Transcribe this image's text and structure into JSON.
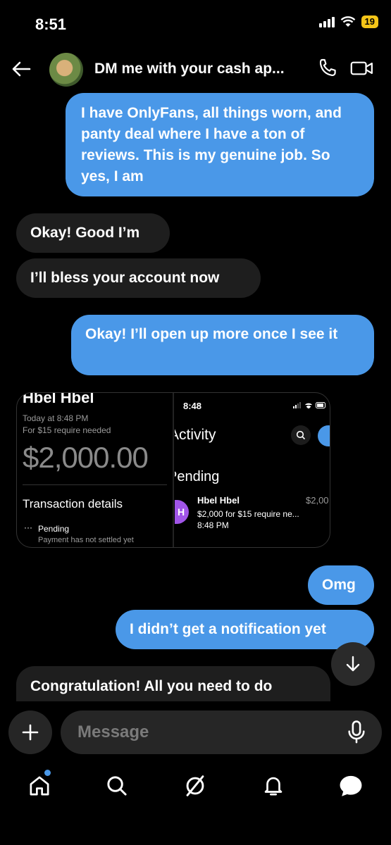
{
  "status_bar": {
    "time": "8:51",
    "battery": "19"
  },
  "header": {
    "title": "DM me with your cash ap..."
  },
  "messages": [
    {
      "direction": "outgoing",
      "text": "I have OnlyFans, all things worn, and panty deal where I have a ton of reviews. This is my genuine job. So yes, I am"
    },
    {
      "direction": "incoming",
      "text": "Okay! Good I’m"
    },
    {
      "direction": "incoming",
      "text": "I’ll bless your account now"
    },
    {
      "direction": "outgoing",
      "text": "Okay! I’ll open up more once I see it"
    },
    {
      "direction": "outgoing",
      "text": "Omg"
    },
    {
      "direction": "outgoing",
      "text": "I didn’t get a notification yet"
    },
    {
      "direction": "incoming",
      "text": "Congratulation! All you need to do"
    }
  ],
  "attachment": {
    "left": {
      "name": "Hbel Hbel",
      "date": "Today at 8:48 PM",
      "note": "For $15 require needed",
      "amount": "$2,000.00",
      "section": "Transaction details",
      "status": "Pending",
      "status_note": "Payment has not settled yet"
    },
    "right": {
      "time": "8:48",
      "heading": "Activity",
      "subheading": "Pending",
      "avatar_letter": "H",
      "name": "Hbel Hbel",
      "amount": "$2,00",
      "desc": "$2,000 for $15 require ne...",
      "time2": "8:48 PM"
    }
  },
  "composer": {
    "placeholder": "Message"
  },
  "colors": {
    "accent": "#4a98e8",
    "incoming_bubble": "#1e1e1e",
    "background": "#000000"
  },
  "icons": [
    "back-arrow-icon",
    "phone-icon",
    "video-icon",
    "plus-icon",
    "mic-icon",
    "home-icon",
    "search-icon",
    "grok-icon",
    "bell-icon",
    "messages-icon",
    "arrow-down-icon"
  ]
}
